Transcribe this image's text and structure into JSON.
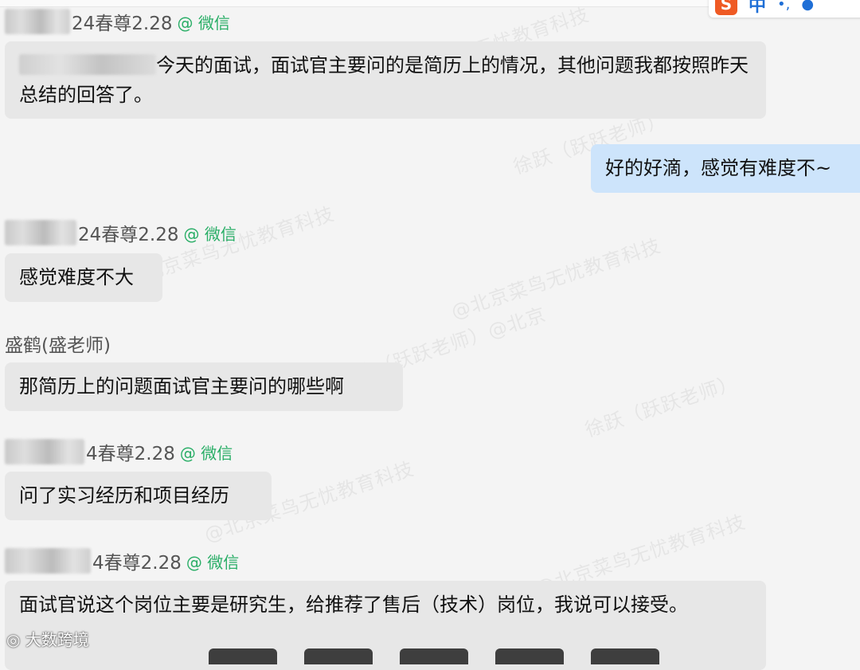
{
  "watermarks": [
    "@北京菜鸟无忧教育科技",
    "徐跃（跃跃老师）",
    "@北京菜鸟无忧教育科技",
    "@北京菜鸟无忧教育科技",
    "（跃跃老师）（跃跃老师）@北京",
    "徐跃（跃跃老师）",
    "@北京菜鸟无忧教育科技",
    "（跃跃老师）@北京菜鸟无忧教育科技"
  ],
  "ime": {
    "logo": "S",
    "lang": "中"
  },
  "messages": [
    {
      "sender": "24春尊2.28",
      "tag": "@ 微信",
      "text_after_blur": "今天的面试，面试官主要问的是简历上的情况，其他问题我都按照昨天总结的回答了。"
    },
    {
      "self_text": "好的好滴，感觉有难度不~"
    },
    {
      "sender": "24春尊2.28",
      "tag": "@ 微信",
      "text": "感觉难度不大"
    },
    {
      "sender": "盛鹤(盛老师)",
      "text": "那简历上的问题面试官主要问的哪些啊"
    },
    {
      "sender": "4春尊2.28",
      "tag": "@ 微信",
      "text": "问了实习经历和项目经历"
    },
    {
      "sender": "4春尊2.28",
      "tag": "@ 微信",
      "text": "面试官说这个岗位主要是研究生，给推荐了售后（技术）岗位，我说可以接受。"
    }
  ],
  "footer": {
    "watermark_logo": "大数跨境"
  }
}
